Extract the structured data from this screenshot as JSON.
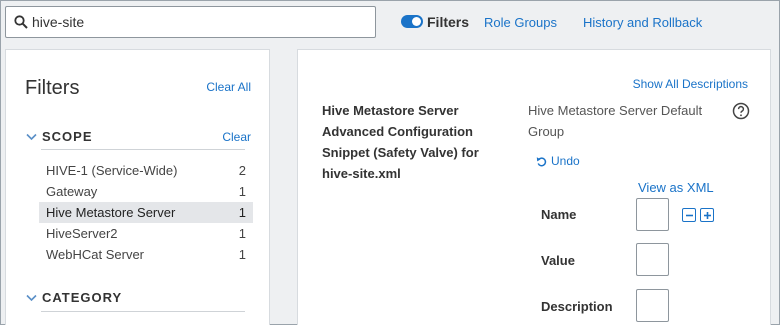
{
  "search": {
    "value": "hive-site"
  },
  "toolbar": {
    "filters_label": "Filters",
    "filters_toggle_on": true,
    "role_groups": "Role Groups",
    "history": "History and Rollback"
  },
  "filters_panel": {
    "title": "Filters",
    "clear_all": "Clear All",
    "scope": {
      "title": "SCOPE",
      "clear": "Clear",
      "items": [
        {
          "label": "HIVE-1 (Service-Wide)",
          "count": "2",
          "selected": false
        },
        {
          "label": "Gateway",
          "count": "1",
          "selected": false
        },
        {
          "label": "Hive Metastore Server",
          "count": "1",
          "selected": true
        },
        {
          "label": "HiveServer2",
          "count": "1",
          "selected": false
        },
        {
          "label": "WebHCat Server",
          "count": "1",
          "selected": false
        }
      ]
    },
    "category": {
      "title": "CATEGORY"
    }
  },
  "config": {
    "show_all_descriptions": "Show All Descriptions",
    "property_name": "Hive Metastore Server Advanced Configuration Snippet (Safety Valve) for hive-site.xml",
    "scope_label": "Hive Metastore Server Default Group",
    "help_icon": "question-circle",
    "undo": "Undo",
    "view_as_xml": "View as XML",
    "fields": {
      "name": "Name",
      "value": "Value",
      "description": "Description"
    }
  },
  "colors": {
    "accent": "#1a73c8",
    "selected_row": "#e4e6e9",
    "background": "#eef0f2"
  }
}
